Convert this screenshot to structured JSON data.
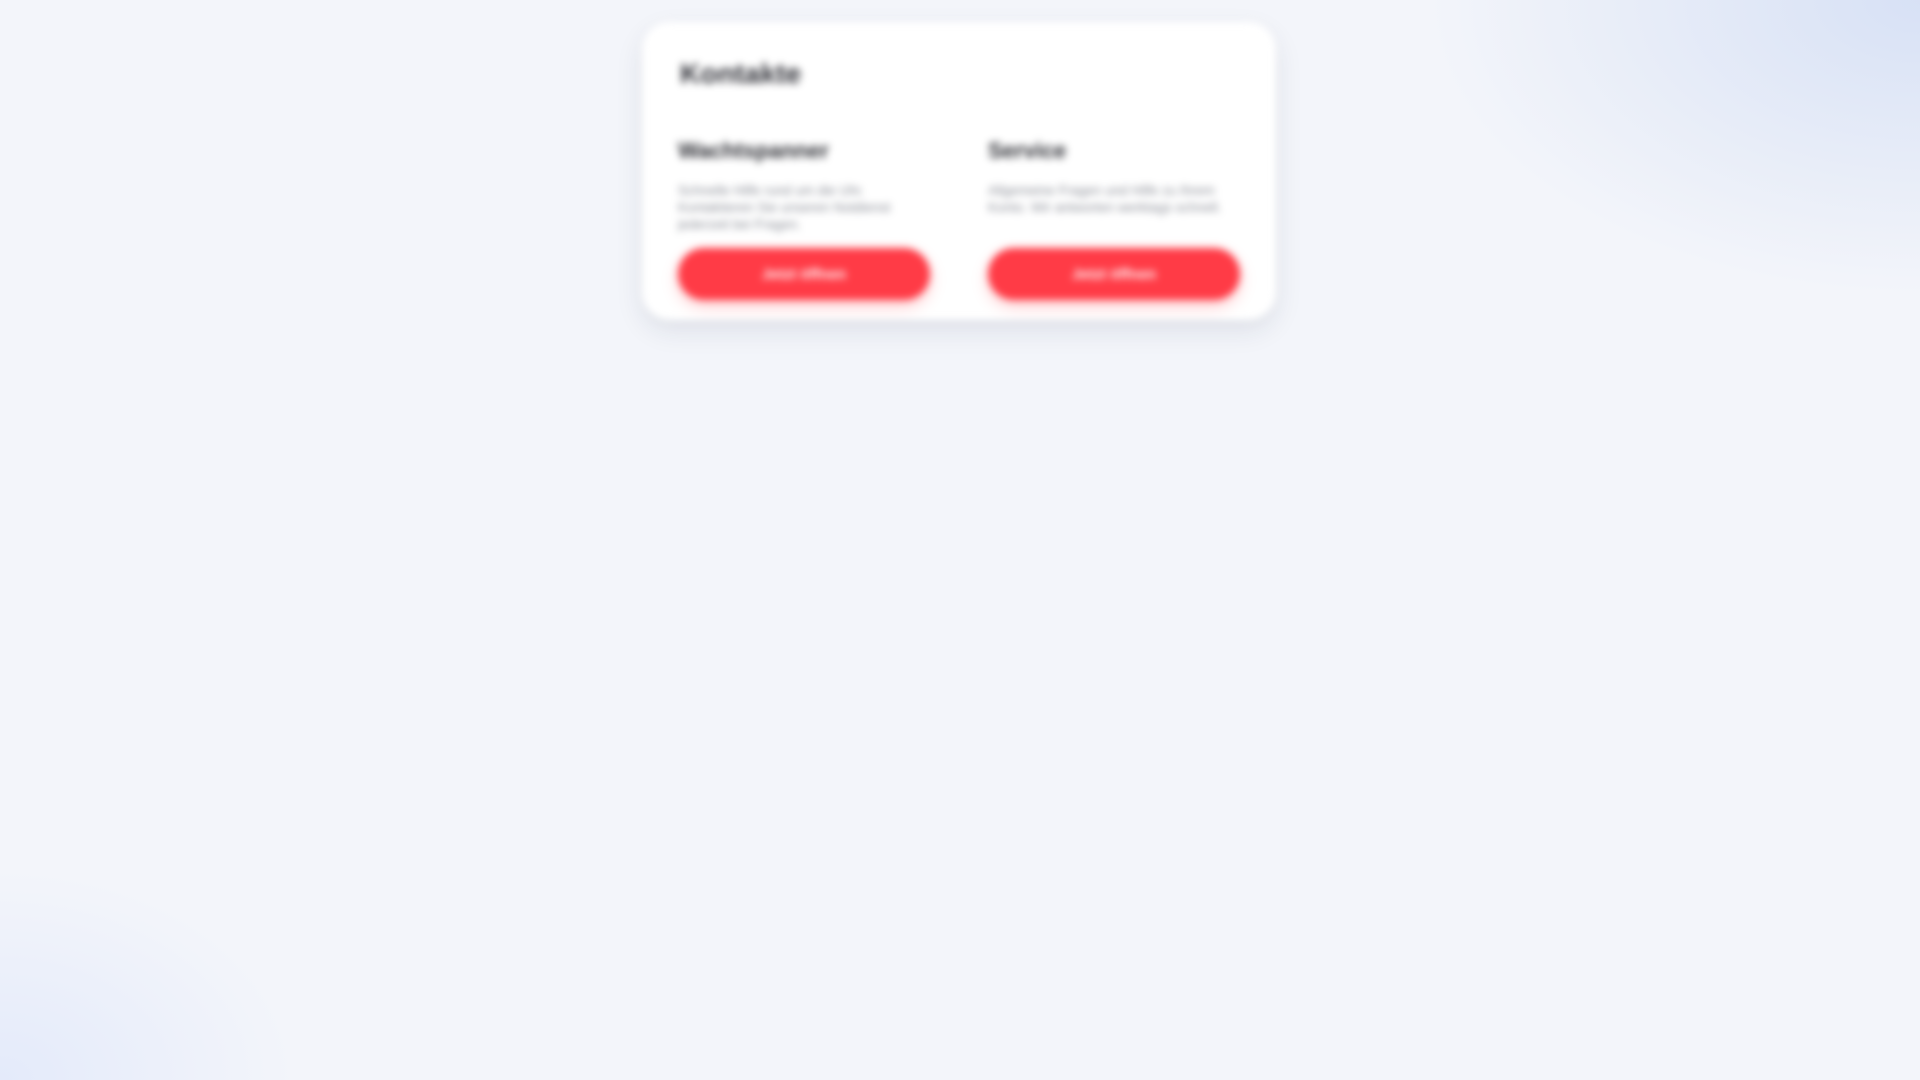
{
  "panel": {
    "title": "Kontakte",
    "cards": [
      {
        "title": "Wachtspanner",
        "description": "Schnelle Hilfe rund um die Uhr. Kontaktieren Sie unseren Notdienst jederzeit bei Fragen.",
        "button_label": "Jetzt öffnen"
      },
      {
        "title": "Service",
        "description": "Allgemeine Fragen und Hilfe zu Ihrem Konto. Wir antworten werktags schnell.",
        "button_label": "Jetzt öffnen"
      }
    ]
  },
  "colors": {
    "accent": "#ff3b46",
    "background": "#f3f5fa",
    "panel": "#ffffff"
  }
}
